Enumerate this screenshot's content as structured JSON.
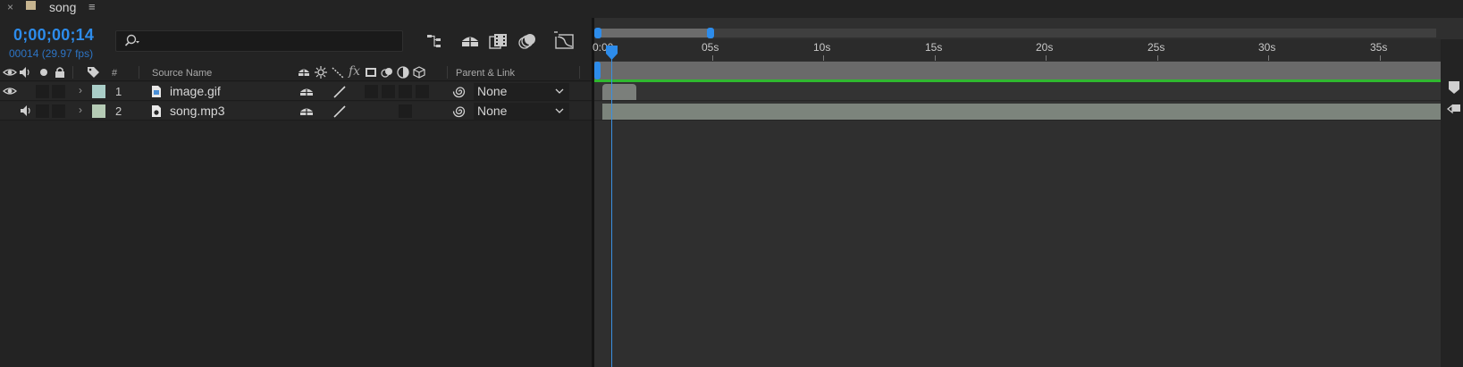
{
  "tab": {
    "close": "×",
    "title": "song",
    "menu": "≡"
  },
  "timecode": {
    "current": "0;00;00;14",
    "frames": "00014 (29.97 fps)"
  },
  "search": {
    "placeholder": ""
  },
  "columns": {
    "number": "#",
    "source_name": "Source Name",
    "parent_link": "Parent & Link"
  },
  "layers": [
    {
      "number": "1",
      "name": "image.gif",
      "label_color": "#a9cdc7",
      "parent": "None",
      "video_visible": true,
      "audio": false
    },
    {
      "number": "2",
      "name": "song.mp3",
      "label_color": "#b5cbb5",
      "parent": "None",
      "video_visible": false,
      "audio": true
    }
  ],
  "ruler": {
    "labels": [
      "0:00",
      "05s",
      "10s",
      "15s",
      "20s",
      "25s",
      "30s",
      "35s"
    ]
  },
  "colors": {
    "accent": "#2d8ceb",
    "work_area": "#6a6a6a",
    "render_bar": "#2fb82f",
    "layer1_bar": "#7b7f7b",
    "layer2_bar": "#7c847c"
  },
  "icons": {
    "search": "search-icon",
    "flowchart": "flowchart-icon",
    "shy": "shy-icon",
    "frame_blend": "frame-blending-icon",
    "motion_blur": "motion-blur-icon",
    "graph_editor": "graph-editor-icon"
  }
}
